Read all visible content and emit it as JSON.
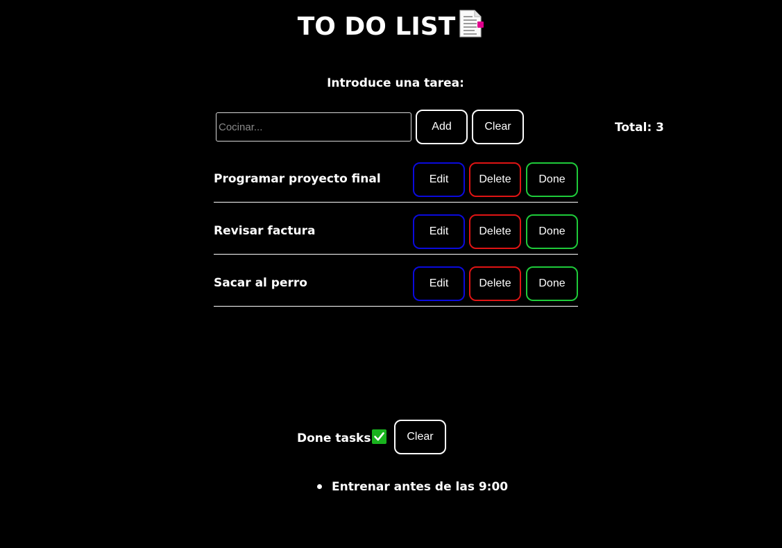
{
  "header": {
    "title": "TO DO LIST",
    "title_icon": "document-icon"
  },
  "form": {
    "prompt": "Introduce una tarea:",
    "input_placeholder": "Cocinar...",
    "input_value": "",
    "add_label": "Add",
    "clear_label": "Clear",
    "total_text": "Total: 3"
  },
  "tasks": [
    {
      "label": "Programar proyecto final",
      "edit": "Edit",
      "delete": "Delete",
      "done": "Done"
    },
    {
      "label": "Revisar factura",
      "edit": "Edit",
      "delete": "Delete",
      "done": "Done"
    },
    {
      "label": "Sacar al perro",
      "edit": "Edit",
      "delete": "Delete",
      "done": "Done"
    }
  ],
  "done_section": {
    "heading": "Done tasks",
    "heading_icon": "check-mark-icon",
    "clear_label": "Clear",
    "items": [
      "Entrenar antes de las 9:00"
    ]
  },
  "colors": {
    "background": "#000000",
    "text": "#ffffff",
    "edit_border": "#0a0add",
    "delete_border": "#e01414",
    "done_border": "#1ecb3a",
    "check_green": "#19b31e"
  }
}
